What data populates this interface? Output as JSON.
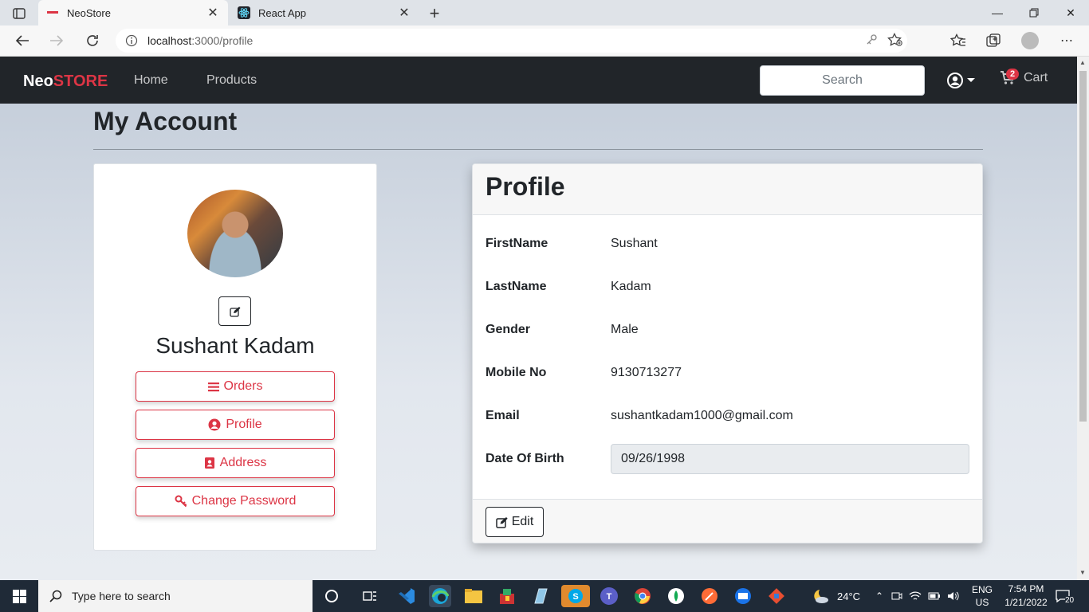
{
  "browser": {
    "tabs": [
      {
        "title": "NeoStore",
        "active": true
      },
      {
        "title": "React App",
        "active": false
      }
    ],
    "url_host": "localhost",
    "url_rest": ":3000/profile"
  },
  "navbar": {
    "brand_neo": "Neo",
    "brand_store": "STORE",
    "links": [
      "Home",
      "Products"
    ],
    "search_placeholder": "Search",
    "cart_label": "Cart",
    "cart_count": "2"
  },
  "page": {
    "title": "My Account",
    "user_name": "Sushant Kadam",
    "menu": [
      {
        "label": "Orders",
        "icon": "bars-icon"
      },
      {
        "label": "Profile",
        "icon": "user-circle-icon"
      },
      {
        "label": "Address",
        "icon": "address-card-icon"
      },
      {
        "label": "Change Password",
        "icon": "key-icon"
      }
    ]
  },
  "profile": {
    "heading": "Profile",
    "fields": [
      {
        "label": "FirstName",
        "value": "Sushant"
      },
      {
        "label": "LastName",
        "value": "Kadam"
      },
      {
        "label": "Gender",
        "value": "Male"
      },
      {
        "label": "Mobile No",
        "value": "9130713277"
      },
      {
        "label": "Email",
        "value": "sushantkadam1000@gmail.com"
      },
      {
        "label": "Date Of Birth",
        "value": "09/26/1998"
      }
    ],
    "edit_label": "Edit"
  },
  "taskbar": {
    "search_text": "Type here to search",
    "temperature": "24°C",
    "lang_top": "ENG",
    "lang_bottom": "US",
    "time": "7:54 PM",
    "date": "1/21/2022",
    "notifications": "20"
  },
  "colors": {
    "accent": "#dc3545",
    "navbar": "#212529"
  }
}
